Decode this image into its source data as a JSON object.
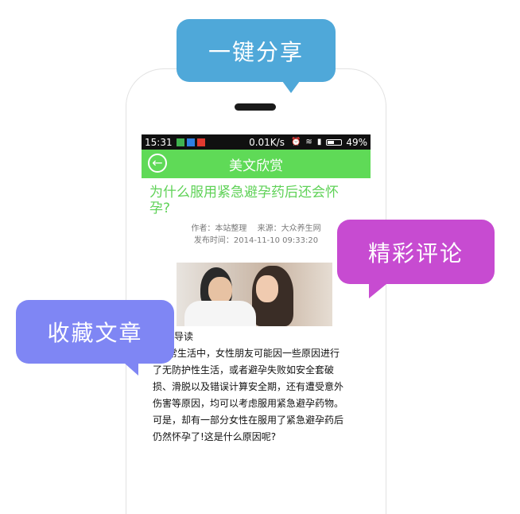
{
  "status_bar": {
    "time": "15:31",
    "speed": "0.01K/s",
    "battery": "49%"
  },
  "top_bar": {
    "title": "美文欣赏"
  },
  "article": {
    "title_line1": "为什么服用紧急避孕药后还会怀",
    "title_line2": "孕?",
    "author": "作者：本站整理",
    "source": "来源：大众养生网",
    "published": "发布时间：2014-11-10 09:33:20",
    "section_heading": "导读",
    "body_lines": [
      "常生活中，女性朋友可能因一些原因进行",
      "了无防护性生活，或者避孕失败如安全套破",
      "损、滑脱以及错误计算安全期，还有遭受意外",
      "伤害等原因，均可以考虑服用紧急避孕药物。",
      "可是，却有一部分女性在服用了紧急避孕药后",
      "仍然怀孕了!这是什么原因呢?"
    ]
  },
  "callouts": {
    "share": "一键分享",
    "comment": "精彩评论",
    "favorite": "收藏文章"
  },
  "colors": {
    "green": "#5fda57",
    "share": "#4fa8d9",
    "comment": "#c74bd1",
    "favorite": "#7f86f4"
  }
}
